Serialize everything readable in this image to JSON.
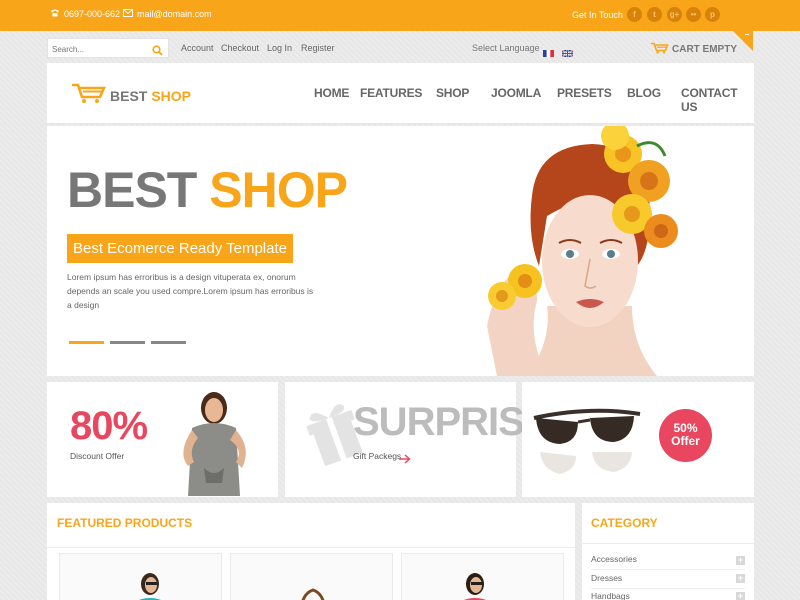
{
  "topbar": {
    "phone": "0697-000-662",
    "email": "mail@domain.com",
    "get_in_touch": "Get In Touch",
    "social_icons": [
      "facebook-icon",
      "twitter-icon",
      "google-plus-icon",
      "flickr-icon",
      "pinterest-icon"
    ]
  },
  "utility": {
    "search_placeholder": "Search...",
    "links": [
      "Account",
      "Checkout",
      "Log In",
      "Register"
    ],
    "select_language": "Select Language",
    "languages": [
      "French",
      "English"
    ],
    "cart_label": "CART EMPTY"
  },
  "header": {
    "logo_word1": "BEST",
    "logo_word2": "SHOP",
    "nav": [
      "HOME",
      "FEATURES",
      "SHOP",
      "JOOMLA",
      "PRESETS",
      "BLOG",
      "CONTACT US"
    ]
  },
  "hero": {
    "title_word1": "BEST",
    "title_word2": "SHOP",
    "tagline": "Best Ecomerce Ready Template",
    "description": "Lorem ipsum has erroribus is a design vituperata ex, onorum depends an scale you used compre.Lorem ipsum has erroribus is a design",
    "slides_total": 3,
    "active_slide": 1
  },
  "promos": {
    "discount_value": "80%",
    "discount_label": "Discount Offer",
    "surprise_title": "SURPRISE",
    "surprise_sub": "Gift Packegs",
    "offer_pct": "50%",
    "offer_word": "Offer"
  },
  "featured": {
    "title": "FEATURED PRODUCTS"
  },
  "category": {
    "title": "CATEGORY",
    "items": [
      "Accessories",
      "Dresses",
      "Handbags"
    ]
  },
  "colors": {
    "accent": "#f9a51a",
    "pink": "#e8475f",
    "text": "#666666"
  }
}
